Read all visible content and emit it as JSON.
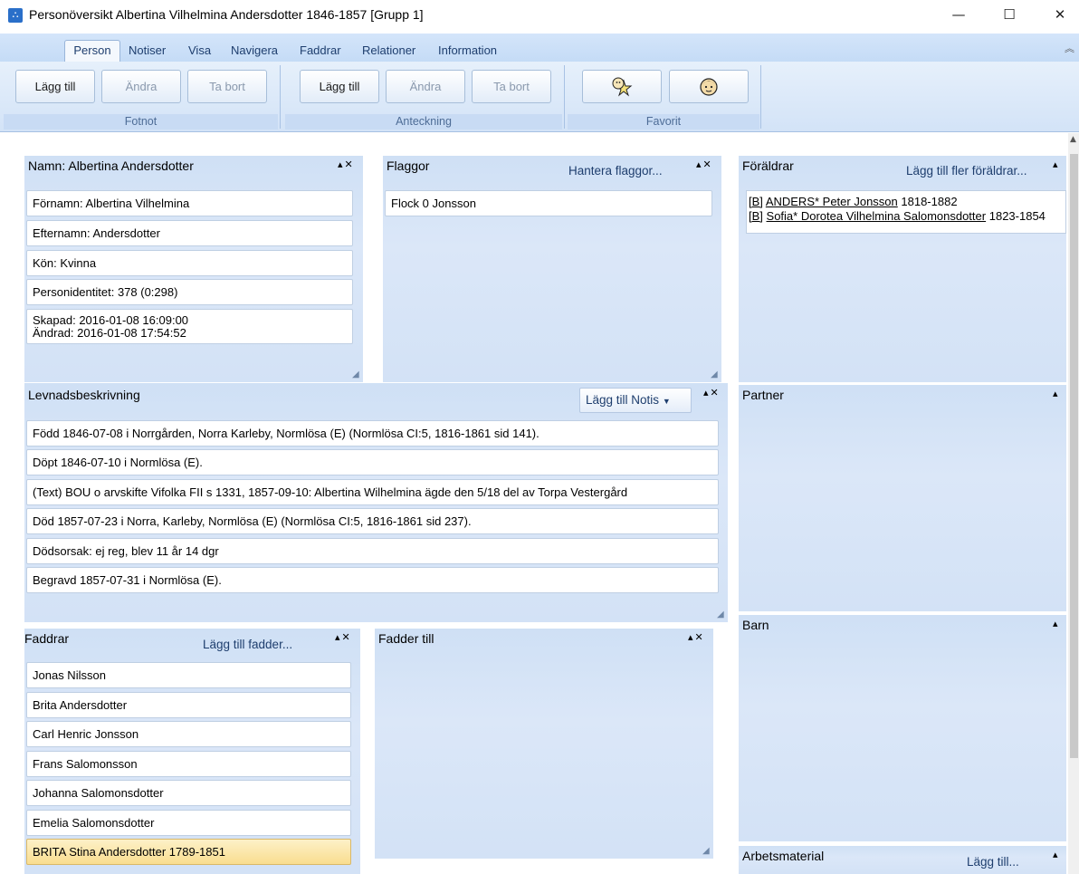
{
  "window": {
    "title": "Personöversikt Albertina Vilhelmina Andersdotter 1846-1857 [Grupp 1]",
    "minimize": "—",
    "maximize": "☐",
    "close": "✕"
  },
  "ribbon": {
    "tabs": [
      "Person",
      "Notiser",
      "Visa",
      "Navigera",
      "Faddrar",
      "Relationer",
      "Information"
    ],
    "collapse_icon": "︽",
    "groups": {
      "fotnot": {
        "label": "Fotnot",
        "add": "Lägg till",
        "edit": "Ändra",
        "delete": "Ta bort"
      },
      "anteckning": {
        "label": "Anteckning",
        "add": "Lägg till",
        "edit": "Ändra",
        "delete": "Ta bort"
      },
      "favorit": {
        "label": "Favorit"
      }
    }
  },
  "name_panel": {
    "title": "Namn: Albertina Andersdotter",
    "fields": [
      "Förnamn: Albertina Vilhelmina",
      "Efternamn: Andersdotter",
      "Kön: Kvinna",
      "Personidentitet: 378 (0:298)"
    ],
    "created": "Skapad: 2016-01-08 16:09:00",
    "changed": "Ändrad: 2016-01-08 17:54:52"
  },
  "flags_panel": {
    "title": "Flaggor",
    "link": "Hantera flaggor...",
    "items": [
      "Flock 0 Jonsson"
    ]
  },
  "parents_panel": {
    "title": "Föräldrar",
    "link": "Lägg till fler föräldrar...",
    "father": {
      "tag": "[B]",
      "name": "ANDERS* Peter Jonsson",
      "years": "1818-1882"
    },
    "mother": {
      "tag": "[B]",
      "name": "Sofia* Dorotea Vilhelmina Salomonsdotter",
      "years": "1823-1854"
    }
  },
  "bio_panel": {
    "title": "Levnadsbeskrivning",
    "add_button": "Lägg till Notis",
    "items": [
      "Född 1846-07-08 i Norrgården, Norra Karleby, Normlösa (E) (Normlösa CI:5, 1816-1861 sid  141).",
      "Döpt 1846-07-10 i Normlösa (E).",
      "(Text) BOU o arvskifte  Vifolka FII s 1331, 1857-09-10:  Albertina Wilhelmina ägde den  5/18 del av Torpa Vestergård",
      "Död 1857-07-23 i Norra, Karleby, Normlösa (E) (Normlösa CI:5, 1816-1861 sid  237).",
      "Dödsorsak: ej reg, blev 11 år 14 dgr",
      "Begravd 1857-07-31 i Normlösa (E)."
    ]
  },
  "partner_panel": {
    "title": "Partner"
  },
  "children_panel": {
    "title": "Barn"
  },
  "godparents_panel": {
    "title": "Faddrar",
    "link": "Lägg till fadder...",
    "items": [
      "Jonas Nilsson",
      "Brita Andersdotter",
      "Carl Henric Jonsson",
      "Frans Salomonsson",
      "Johanna Salomonsdotter",
      "Emelia Salomonsdotter",
      "BRITA Stina Andersdotter 1789-1851"
    ]
  },
  "godparent_of_panel": {
    "title": "Fadder till"
  },
  "work_material_panel": {
    "title": "Arbetsmaterial",
    "link": "Lägg till..."
  },
  "colors": {
    "panel_bg": "#d3e2f6",
    "ribbon_bg": "#dce9f9",
    "selected_item": "#fbe6a6",
    "link_text": "#1e3e6e"
  }
}
